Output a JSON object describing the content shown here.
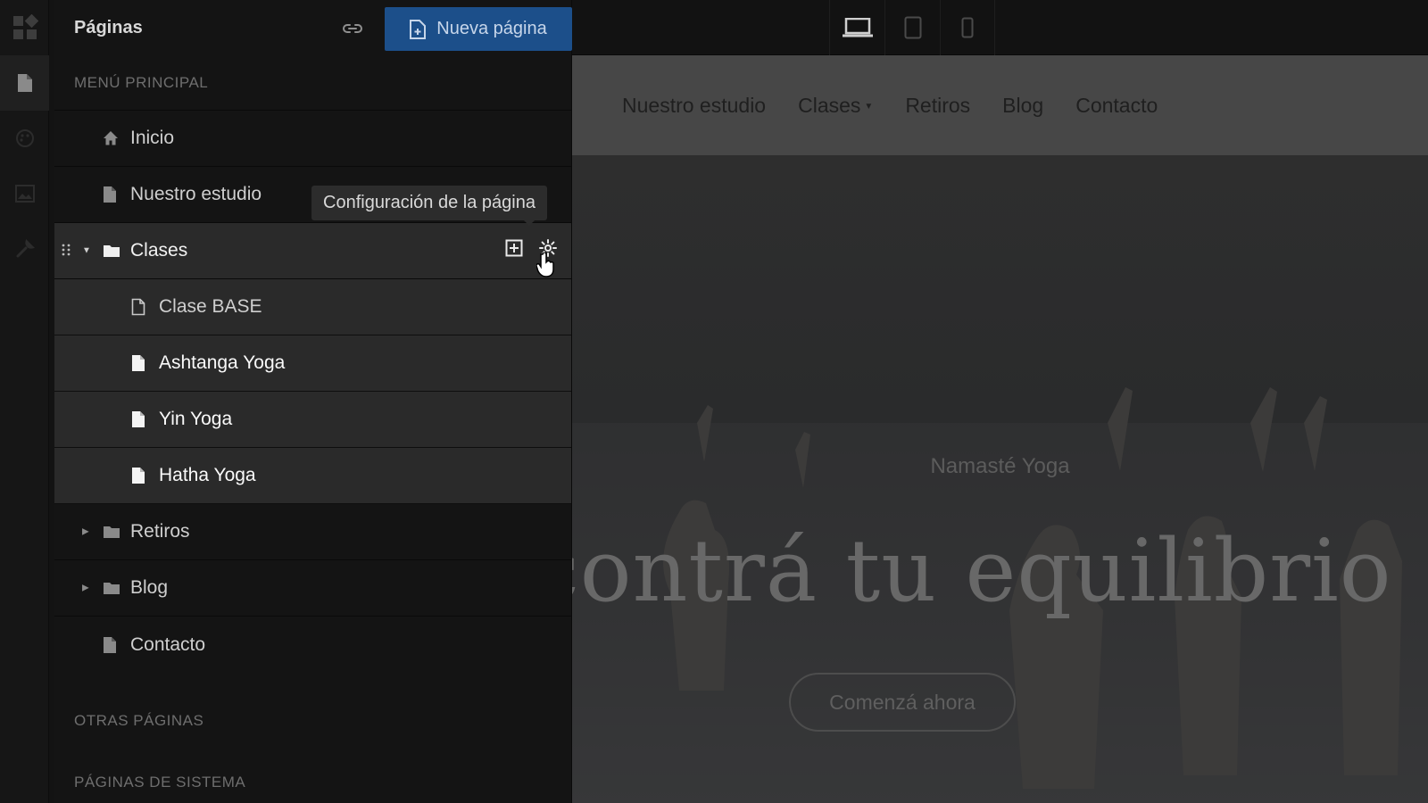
{
  "rail": {
    "items": [
      {
        "icon": "dashboard-icon",
        "active": false
      },
      {
        "icon": "page-icon",
        "active": true
      },
      {
        "icon": "palette-icon",
        "active": false
      },
      {
        "icon": "image-icon",
        "active": false
      },
      {
        "icon": "wrench-icon",
        "active": false
      }
    ]
  },
  "panel": {
    "title": "Páginas",
    "new_page_label": "Nueva página",
    "main_menu_label": "MENÚ PRINCIPAL",
    "other_pages_label": "OTRAS PÁGINAS",
    "system_pages_label": "PÁGINAS DE SISTEMA",
    "items": [
      {
        "label": "Inicio",
        "icon": "home-icon"
      },
      {
        "label": "Nuestro estudio",
        "icon": "page-icon"
      },
      {
        "label": "Clases",
        "icon": "folder-icon",
        "expanded": true,
        "selected": true,
        "children": [
          {
            "label": "Clase BASE",
            "icon": "page-outline-icon"
          },
          {
            "label": "Ashtanga Yoga",
            "icon": "page-icon"
          },
          {
            "label": "Yin Yoga",
            "icon": "page-icon"
          },
          {
            "label": "Hatha Yoga",
            "icon": "page-icon"
          }
        ]
      },
      {
        "label": "Retiros",
        "icon": "folder-icon",
        "expanded": false
      },
      {
        "label": "Blog",
        "icon": "folder-icon",
        "expanded": false
      },
      {
        "label": "Contacto",
        "icon": "page-icon"
      }
    ],
    "tooltip": "Configuración de la página"
  },
  "toolbar": {
    "devices": [
      "desktop-icon",
      "tablet-icon",
      "mobile-icon"
    ]
  },
  "site": {
    "nav": [
      "Nuestro estudio",
      "Clases",
      "Retiros",
      "Blog",
      "Contacto"
    ],
    "hero_subtitle": "Namasté Yoga",
    "hero_title": "contrá tu equilibrio",
    "hero_button": "Comenzá ahora"
  }
}
